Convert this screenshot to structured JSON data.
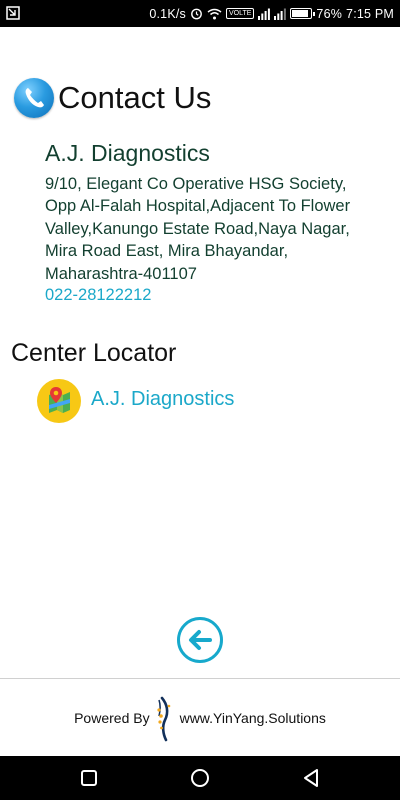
{
  "status_bar": {
    "speed": "0.1K/s",
    "volte": "VOLTE",
    "battery_percent": "76%",
    "battery_level": 0.76,
    "time": "7:15 PM"
  },
  "contact": {
    "title": "Contact Us",
    "lab_name": "A.J. Diagnostics",
    "address_lines": [
      "9/10, Elegant Co Operative HSG Society,",
      "Opp Al-Falah Hospital,Adjacent To Flower",
      "Valley,Kanungo Estate Road,Naya Nagar,",
      "Mira Road East, Mira Bhayandar,",
      "Maharashtra-401107"
    ],
    "phone": "022-28122212",
    "icon": "phone-icon"
  },
  "center_locator": {
    "title": "Center Locator",
    "link_label": "A.J. Diagnostics",
    "icon": "map-pin-icon"
  },
  "back": {
    "icon": "back-arrow-icon"
  },
  "footer": {
    "powered_by": "Powered By",
    "site": "www.YinYang.Solutions"
  },
  "colors": {
    "accent": "#1ba8c9",
    "text_dark_green": "#123f2f",
    "map_icon_bg": "#f7c815"
  }
}
